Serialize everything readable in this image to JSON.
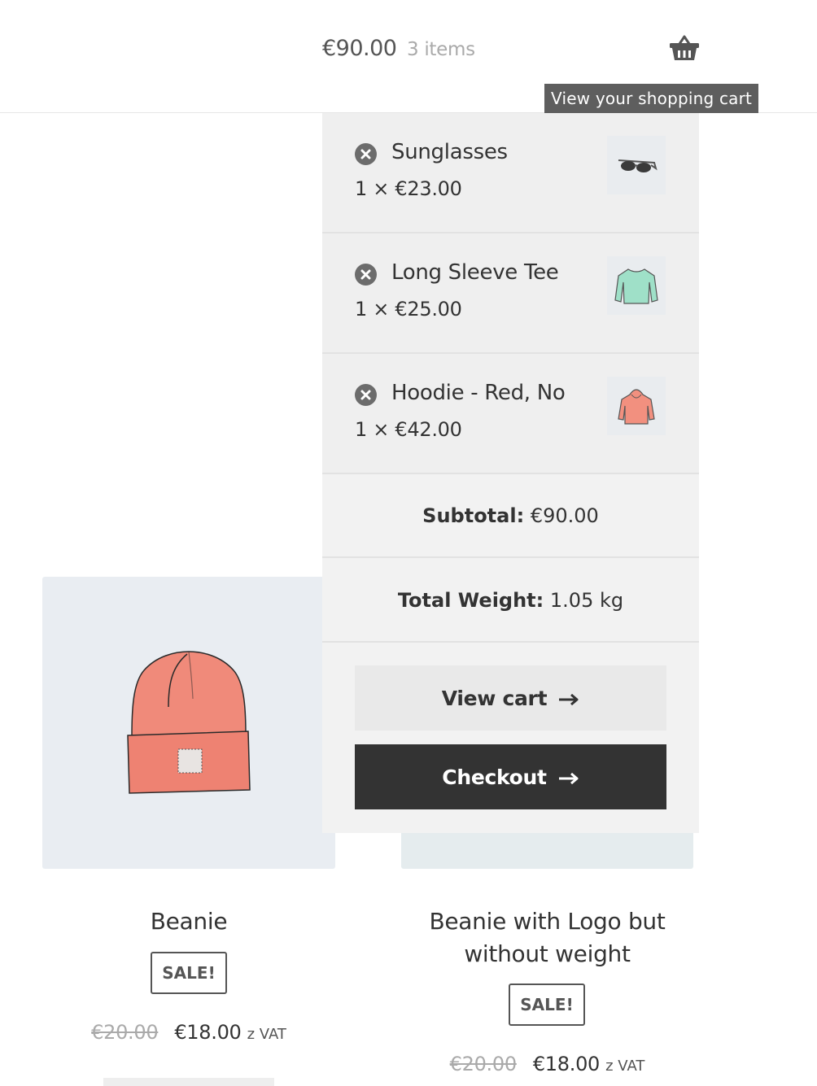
{
  "header": {
    "cart_total": "€90.00",
    "cart_count": "3 items",
    "cart_icon": "basket-icon",
    "tooltip": "View your shopping cart"
  },
  "mini_cart": {
    "items": [
      {
        "name": "Sunglasses",
        "quantity_price": "1 × €23.00",
        "thumbnail": "sunglasses-thumbnail"
      },
      {
        "name": "Long Sleeve Tee",
        "quantity_price": "1 × €25.00",
        "thumbnail": "long-sleeve-tee-thumbnail"
      },
      {
        "name": "Hoodie - Red, No",
        "quantity_price": "1 × €42.00",
        "thumbnail": "hoodie-thumbnail"
      }
    ],
    "remove_icon": "remove-x-icon",
    "subtotal_label": "Subtotal:",
    "subtotal_value": "€90.00",
    "weight_label": "Total Weight:",
    "weight_value": "1.05 kg",
    "view_cart_label": "View cart",
    "checkout_label": "Checkout",
    "arrow_icon": "arrow-right-icon"
  },
  "products": [
    {
      "title": "Beanie",
      "badge": "SALE!",
      "old_price": "€20.00",
      "new_price": "€18.00",
      "tax_suffix": "z VAT"
    },
    {
      "title": "Beanie with Logo but without weight",
      "badge": "SALE!",
      "old_price": "€20.00",
      "new_price": "€18.00",
      "tax_suffix": "z VAT"
    }
  ],
  "colors": {
    "dark_button": "#333333",
    "light_button": "#e9e9e9",
    "tooltip_bg": "#5e5e5e",
    "beanie": "#f08a7a"
  }
}
